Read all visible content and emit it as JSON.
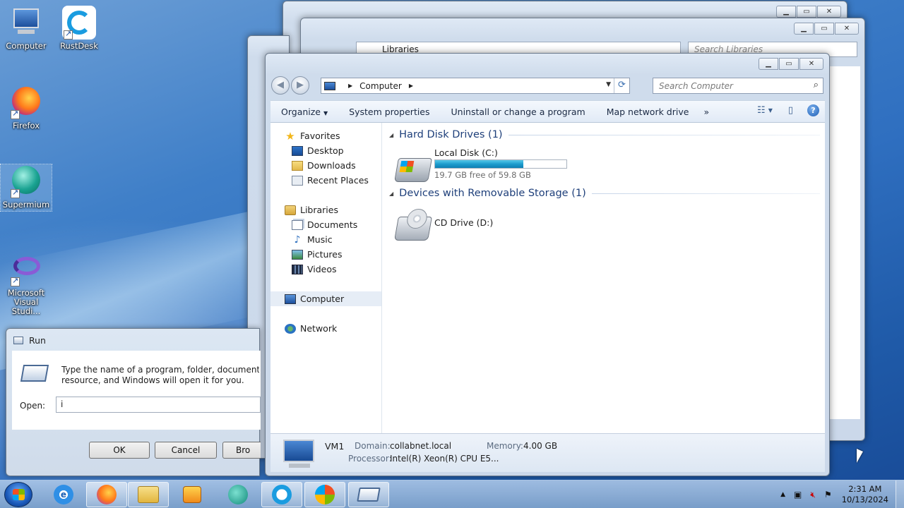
{
  "desktop": {
    "icons": [
      {
        "label": "Computer",
        "icon": "computer-icon"
      },
      {
        "label": "RustDesk",
        "icon": "rustdesk-icon"
      },
      {
        "label": "Firefox",
        "icon": "firefox-icon"
      },
      {
        "label": "Supermium",
        "icon": "supermium-icon"
      },
      {
        "label": "Microsoft Visual Studi...",
        "icon": "visual-studio-icon"
      }
    ]
  },
  "back_window": {
    "breadcrumb": "Libraries",
    "search_placeholder": "Search Libraries"
  },
  "explorer": {
    "breadcrumb": "Computer",
    "search_placeholder": "Search Computer",
    "toolbar": {
      "organize": "Organize",
      "system_properties": "System properties",
      "uninstall": "Uninstall or change a program",
      "map_drive": "Map network drive",
      "more": "»"
    },
    "nav": {
      "favorites": "Favorites",
      "desktop": "Desktop",
      "downloads": "Downloads",
      "recent": "Recent Places",
      "libraries": "Libraries",
      "documents": "Documents",
      "music": "Music",
      "pictures": "Pictures",
      "videos": "Videos",
      "computer": "Computer",
      "network": "Network"
    },
    "groups": {
      "hdd_header": "Hard Disk Drives (1)",
      "removable_header": "Devices with Removable Storage (1)"
    },
    "drives": {
      "c_name": "Local Disk (C:)",
      "c_free_text": "19.7 GB free of 59.8 GB",
      "c_used_fraction": 0.67,
      "d_name": "CD Drive (D:)"
    },
    "details": {
      "name": "VM1",
      "domain_label": "Domain:",
      "domain_value": "collabnet.local",
      "memory_label": "Memory:",
      "memory_value": "4.00 GB",
      "processor_label": "Processor:",
      "processor_value": "Intel(R) Xeon(R) CPU E5..."
    }
  },
  "run_dialog": {
    "title": "Run",
    "description_line1": "Type the name of a program, folder, document, or I",
    "description_line2": "resource, and Windows will open it for you.",
    "open_label": "Open:",
    "open_value": "i",
    "ok": "OK",
    "cancel": "Cancel",
    "browse": "Bro"
  },
  "taskbar": {
    "ie_glyph": "e",
    "time": "2:31 AM",
    "date": "10/13/2024"
  }
}
